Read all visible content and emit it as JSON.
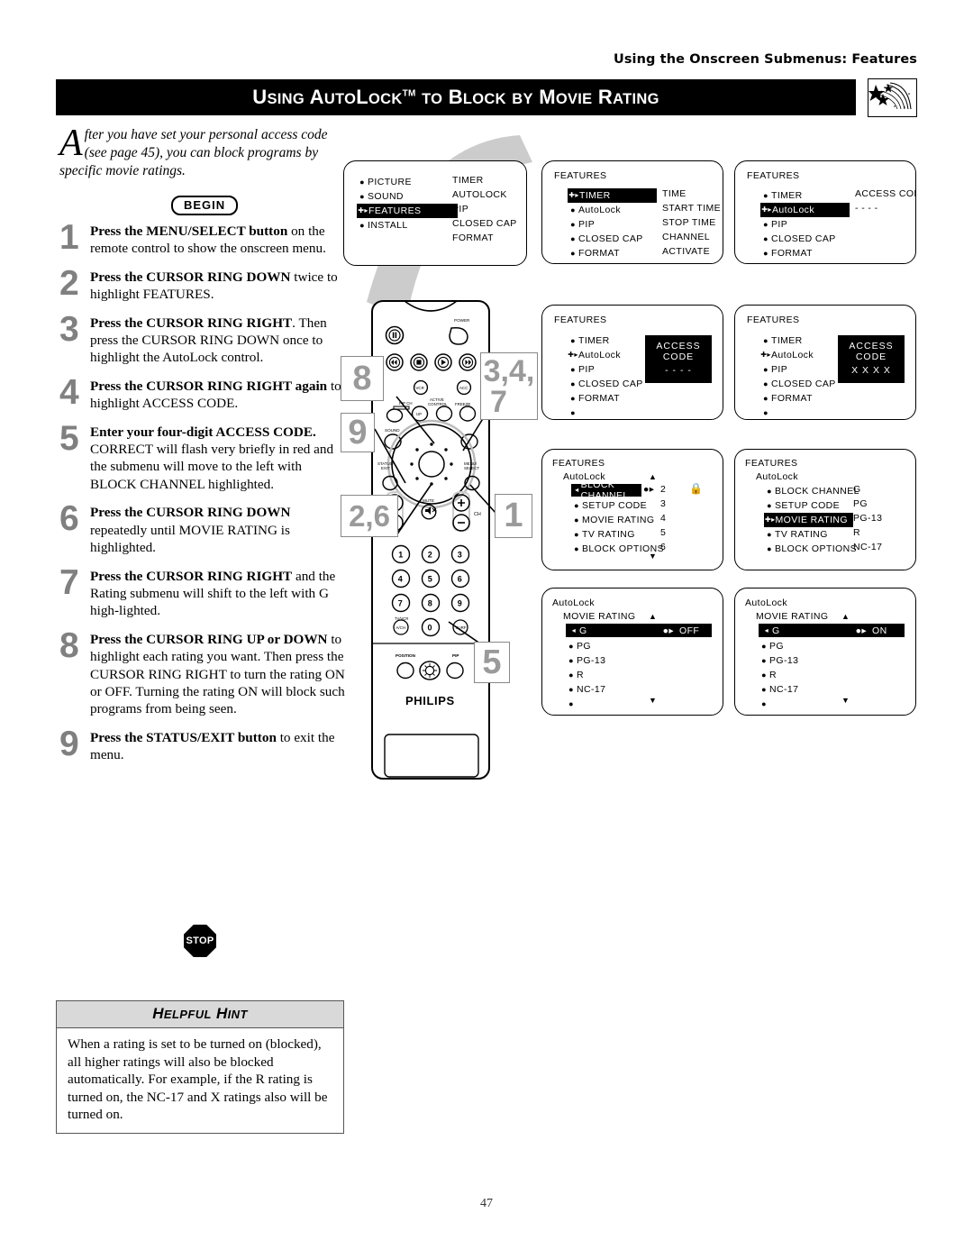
{
  "running_head": "Using the Onscreen Submenus: Features",
  "page_title": {
    "parts": [
      {
        "big": "U",
        "small": "SING"
      },
      {
        "big": "A",
        "small": "UTO"
      },
      {
        "big": "L",
        "small": "OCK"
      },
      {
        "sup": "TM"
      },
      {
        "big": "T",
        "small": "O"
      },
      {
        "big": "B",
        "small": "LOCK"
      },
      {
        "big": "B",
        "small": "Y"
      },
      {
        "big": "M",
        "small": "OVIE"
      },
      {
        "big": "R",
        "small": "ATING"
      }
    ],
    "plain": "Using AutoLock TM to Block by Movie Rating"
  },
  "logo_alt": "philips-shooting-star-logo",
  "intro": {
    "dropcap": "A",
    "text": "fter you have set your personal access code (see page 45), you can block programs by specific movie ratings."
  },
  "begin_label": "BEGIN",
  "stop_label": "STOP",
  "steps": [
    {
      "num": "1",
      "bold": "Press the MENU/SELECT button",
      "rest": " on the remote control to show the onscreen menu."
    },
    {
      "num": "2",
      "bold": "Press the CURSOR RING DOWN",
      "rest": " twice to highlight FEATURES."
    },
    {
      "num": "3",
      "bold": "Press the CURSOR RING RIGHT",
      "rest": ". Then press the CURSOR RING DOWN once to highlight the AutoLock control."
    },
    {
      "num": "4",
      "bold": "Press the CURSOR RING RIGHT again",
      "rest": " to highlight ACCESS CODE."
    },
    {
      "num": "5",
      "bold": "Enter your four-digit ACCESS CODE.",
      "rest": " CORRECT will flash very briefly in red and the submenu will move to the left with BLOCK CHANNEL highlighted."
    },
    {
      "num": "6",
      "bold": "Press the CURSOR RING DOWN",
      "rest": " repeatedly until MOVIE RATING is highlighted."
    },
    {
      "num": "7",
      "bold": "Press the CURSOR RING RIGHT",
      "rest": " and the Rating submenu will shift to the left with G high-lighted."
    },
    {
      "num": "8",
      "bold": "Press the CURSOR RING UP or DOWN",
      "rest": " to highlight each rating you want. Then press the CURSOR RING RIGHT to turn the rating ON or OFF. Turning the rating ON will block such programs from being seen."
    },
    {
      "num": "9",
      "bold": "Press the STATUS/EXIT button",
      "rest": " to exit the menu."
    }
  ],
  "hint": {
    "title_parts": [
      {
        "big": "H",
        "small": "ELPFUL"
      },
      {
        "big": "H",
        "small": "INT"
      }
    ],
    "title_plain": "Helpful Hint",
    "body": "When a rating is set to be turned on (blocked), all higher ratings will also be blocked automatically. For example, if the R rating is turned on, the NC-17 and X ratings also will be turned on."
  },
  "page_number": "47",
  "remote": {
    "brand": "PHILIPS",
    "labels": {
      "power": "POWER",
      "vcr": "VCR",
      "acc": "ACC",
      "active_control": "ACTIVE CONTROL",
      "freeze": "FREEZE",
      "pip_ch": "PIP CH",
      "up": "UP",
      "sound": "SOUND",
      "status_exit": "STATUS/ EXIT",
      "menu_select": "MENU/ SELECT",
      "mute": "MUTE",
      "ch": "CH",
      "vol": "VOL",
      "tv_vcr": "TV/VCR A/CH",
      "surf": "SURF",
      "position": "POSITION",
      "pip": "PIP"
    },
    "keypad": [
      "1",
      "2",
      "3",
      "4",
      "5",
      "6",
      "7",
      "8",
      "9",
      "0"
    ]
  },
  "callouts": [
    {
      "id": "callout-1",
      "label": "1"
    },
    {
      "id": "callout-2-6",
      "label": "2,6"
    },
    {
      "id": "callout-3-4-7",
      "label": "3,4,\n7"
    },
    {
      "id": "callout-5",
      "label": "5"
    },
    {
      "id": "callout-8",
      "label": "8"
    },
    {
      "id": "callout-9",
      "label": "9"
    }
  ],
  "screens": {
    "main_menu": {
      "left_items": [
        {
          "label": "PICTURE",
          "marker": "bullet",
          "highlight": false
        },
        {
          "label": "SOUND",
          "marker": "bullet",
          "highlight": false
        },
        {
          "label": "FEATURES",
          "marker": "cursor",
          "highlight": true
        },
        {
          "label": "INSTALL",
          "marker": "bullet",
          "highlight": false
        }
      ],
      "right_items": [
        "TIMER",
        "AUTOLOCK",
        "PIP",
        "CLOSED CAP",
        "FORMAT"
      ]
    },
    "features_timer": {
      "header": "FEATURES",
      "left_items": [
        {
          "label": "TIMER",
          "marker": "cursor",
          "highlight": true
        },
        {
          "label": "AutoLock",
          "marker": "bullet",
          "highlight": false
        },
        {
          "label": "PIP",
          "marker": "bullet",
          "highlight": false
        },
        {
          "label": "CLOSED CAP",
          "marker": "bullet",
          "highlight": false
        },
        {
          "label": "FORMAT",
          "marker": "bullet",
          "highlight": false
        },
        {
          "label": "",
          "marker": "bullet",
          "highlight": false
        }
      ],
      "right_items": [
        "TIME",
        "START TIME",
        "STOP TIME",
        "CHANNEL",
        "ACTIVATE"
      ]
    },
    "features_autolock": {
      "header": "FEATURES",
      "left_items": [
        {
          "label": "TIMER",
          "marker": "bullet",
          "highlight": false
        },
        {
          "label": "AutoLock",
          "marker": "cursor",
          "highlight": true
        },
        {
          "label": "PIP",
          "marker": "bullet",
          "highlight": false
        },
        {
          "label": "CLOSED CAP",
          "marker": "bullet",
          "highlight": false
        },
        {
          "label": "FORMAT",
          "marker": "bullet",
          "highlight": false
        },
        {
          "label": "",
          "marker": "bullet",
          "highlight": false
        }
      ],
      "right_items": [
        "ACCESS CODE",
        "- - - -"
      ]
    },
    "access_code_empty": {
      "header": "FEATURES",
      "left_items": [
        {
          "label": "TIMER",
          "marker": "bullet",
          "highlight": false
        },
        {
          "label": "AutoLock",
          "marker": "cursor",
          "highlight": false
        },
        {
          "label": "PIP",
          "marker": "bullet",
          "highlight": false
        },
        {
          "label": "CLOSED CAP",
          "marker": "bullet",
          "highlight": false
        },
        {
          "label": "FORMAT",
          "marker": "bullet",
          "highlight": false
        },
        {
          "label": "",
          "marker": "bullet",
          "highlight": false
        }
      ],
      "box_title": "ACCESS CODE",
      "box_value": "- - - -"
    },
    "access_code_filled": {
      "header": "FEATURES",
      "left_items": [
        {
          "label": "TIMER",
          "marker": "bullet",
          "highlight": false
        },
        {
          "label": "AutoLock",
          "marker": "cursor",
          "highlight": false
        },
        {
          "label": "PIP",
          "marker": "bullet",
          "highlight": false
        },
        {
          "label": "CLOSED CAP",
          "marker": "bullet",
          "highlight": false
        },
        {
          "label": "FORMAT",
          "marker": "bullet",
          "highlight": false
        },
        {
          "label": "",
          "marker": "bullet",
          "highlight": false
        }
      ],
      "box_title": "ACCESS CODE",
      "box_value": "X X X X"
    },
    "autolock_block_channel": {
      "header": "FEATURES",
      "subheader": "AutoLock",
      "items": [
        {
          "label": "BLOCK CHANNEL",
          "value": "2",
          "highlight": true
        },
        {
          "label": "SETUP CODE",
          "value": "3",
          "highlight": false
        },
        {
          "label": "MOVIE RATING",
          "value": "4",
          "highlight": false
        },
        {
          "label": "TV RATING",
          "value": "5",
          "highlight": false
        },
        {
          "label": "BLOCK OPTIONS",
          "value": "6",
          "highlight": false
        }
      ],
      "scroll_up": "▲",
      "scroll_down": "▼",
      "lock_icon": "lock-icon"
    },
    "autolock_movie_rating": {
      "header": "FEATURES",
      "subheader": "AutoLock",
      "items": [
        {
          "label": "BLOCK CHANNEL",
          "value": "G",
          "highlight": false
        },
        {
          "label": "SETUP CODE",
          "value": "PG",
          "highlight": false
        },
        {
          "label": "MOVIE RATING",
          "value": "PG-13",
          "highlight": true
        },
        {
          "label": "TV RATING",
          "value": "R",
          "highlight": false
        },
        {
          "label": "BLOCK OPTIONS",
          "value": "NC-17",
          "highlight": false
        }
      ]
    },
    "rating_off": {
      "header": "AutoLock",
      "subheader": "MOVIE RATING",
      "items": [
        {
          "label": "G",
          "highlight": true,
          "value": "OFF"
        },
        {
          "label": "PG",
          "highlight": false,
          "value": ""
        },
        {
          "label": "PG-13",
          "highlight": false,
          "value": ""
        },
        {
          "label": "R",
          "highlight": false,
          "value": ""
        },
        {
          "label": "NC-17",
          "highlight": false,
          "value": ""
        },
        {
          "label": "",
          "highlight": false,
          "value": ""
        }
      ],
      "scroll_up": "▲",
      "scroll_down": "▼"
    },
    "rating_on": {
      "header": "AutoLock",
      "subheader": "MOVIE RATING",
      "items": [
        {
          "label": "G",
          "highlight": true,
          "value": "ON"
        },
        {
          "label": "PG",
          "highlight": false,
          "value": ""
        },
        {
          "label": "PG-13",
          "highlight": false,
          "value": ""
        },
        {
          "label": "R",
          "highlight": false,
          "value": ""
        },
        {
          "label": "NC-17",
          "highlight": false,
          "value": ""
        },
        {
          "label": "",
          "highlight": false,
          "value": ""
        }
      ],
      "scroll_up": "▲",
      "scroll_down": "▼"
    }
  }
}
